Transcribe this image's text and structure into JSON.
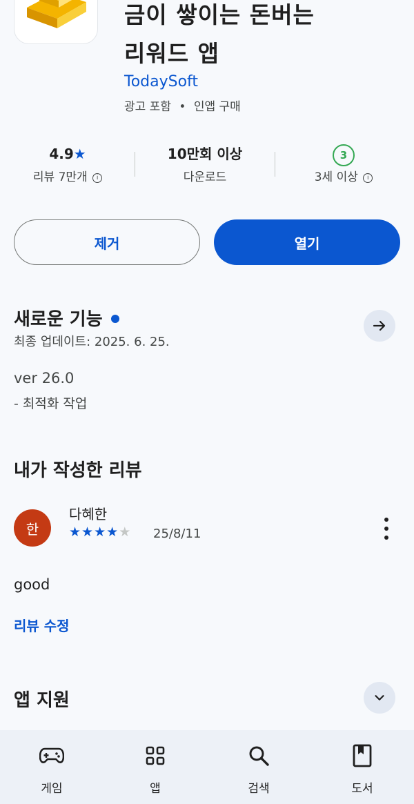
{
  "app": {
    "title_line1": "금이 쌓이는 돈버는",
    "title_line2": "리워드 앱",
    "developer": "TodaySoft",
    "meta_ads": "광고 포함",
    "meta_sep": "•",
    "meta_iap": "인앱 구매"
  },
  "stats": {
    "rating": "4.9",
    "rating_star": "★",
    "reviews_label": "리뷰 7만개",
    "downloads": "10만회 이상",
    "downloads_label": "다운로드",
    "age_badge": "3",
    "age_label": "3세 이상"
  },
  "actions": {
    "remove_label": "제거",
    "open_label": "열기"
  },
  "whats_new": {
    "title": "새로운 기능",
    "updated": "최종 업데이트: 2025. 6. 25.",
    "version": "ver 26.0",
    "note": "- 최적화 작업"
  },
  "my_review": {
    "title": "내가 작성한 리뷰",
    "avatar_letter": "한",
    "author": "다혜한",
    "rating": 4,
    "rating_max": 5,
    "date": "25/8/11",
    "text": "good",
    "edit_label": "리뷰 수정"
  },
  "app_support": {
    "title": "앱 지원"
  },
  "bottom_nav": {
    "items": [
      {
        "label": "게임",
        "icon": "gamepad-icon"
      },
      {
        "label": "앱",
        "icon": "apps-grid-icon"
      },
      {
        "label": "검색",
        "icon": "search-icon"
      },
      {
        "label": "도서",
        "icon": "book-icon"
      }
    ]
  },
  "colors": {
    "accent": "#0b57d0",
    "avatar": "#c43a14",
    "age_badge": "#34a853",
    "background": "#f7f9fc",
    "nav_background": "#edf1f7"
  }
}
